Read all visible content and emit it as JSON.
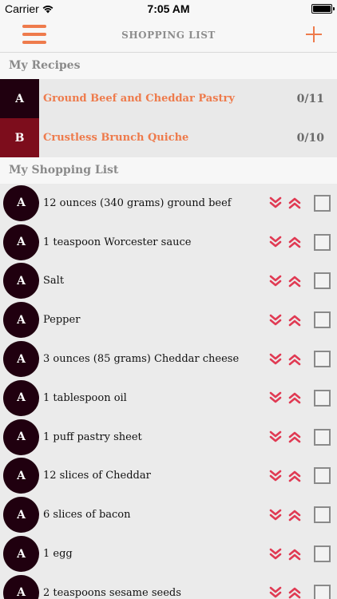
{
  "status_bar": {
    "carrier": "Carrier",
    "time": "7:05 AM",
    "wifi_icon": "wifi-icon",
    "battery_icon": "battery-icon"
  },
  "nav": {
    "title": "SHOPPING LIST",
    "menu_icon": "hamburger-menu-icon",
    "add_icon": "plus-icon"
  },
  "colors": {
    "accent": "#ee7b4c",
    "recipe_a": "#20000f",
    "recipe_b": "#7d0d1c",
    "chevron": "#e03a53"
  },
  "recipes_section": {
    "title": "My Recipes"
  },
  "recipes": [
    {
      "letter": "A",
      "name": "Ground Beef and Cheddar Pastry",
      "count": "0/11"
    },
    {
      "letter": "B",
      "name": "Crustless Brunch Quiche",
      "count": "0/10"
    }
  ],
  "list_section": {
    "title": "My Shopping List"
  },
  "items": [
    {
      "letter": "A",
      "text": "12 ounces (340 grams) ground beef"
    },
    {
      "letter": "A",
      "text": "1 teaspoon Worcester sauce"
    },
    {
      "letter": "A",
      "text": "Salt"
    },
    {
      "letter": "A",
      "text": "Pepper"
    },
    {
      "letter": "A",
      "text": "3 ounces (85 grams) Cheddar cheese"
    },
    {
      "letter": "A",
      "text": "1 tablespoon oil"
    },
    {
      "letter": "A",
      "text": "1 puff pastry sheet"
    },
    {
      "letter": "A",
      "text": "12 slices of Cheddar"
    },
    {
      "letter": "A",
      "text": "6 slices of bacon"
    },
    {
      "letter": "A",
      "text": "1 egg"
    },
    {
      "letter": "A",
      "text": "2 teaspoons sesame seeds"
    }
  ]
}
